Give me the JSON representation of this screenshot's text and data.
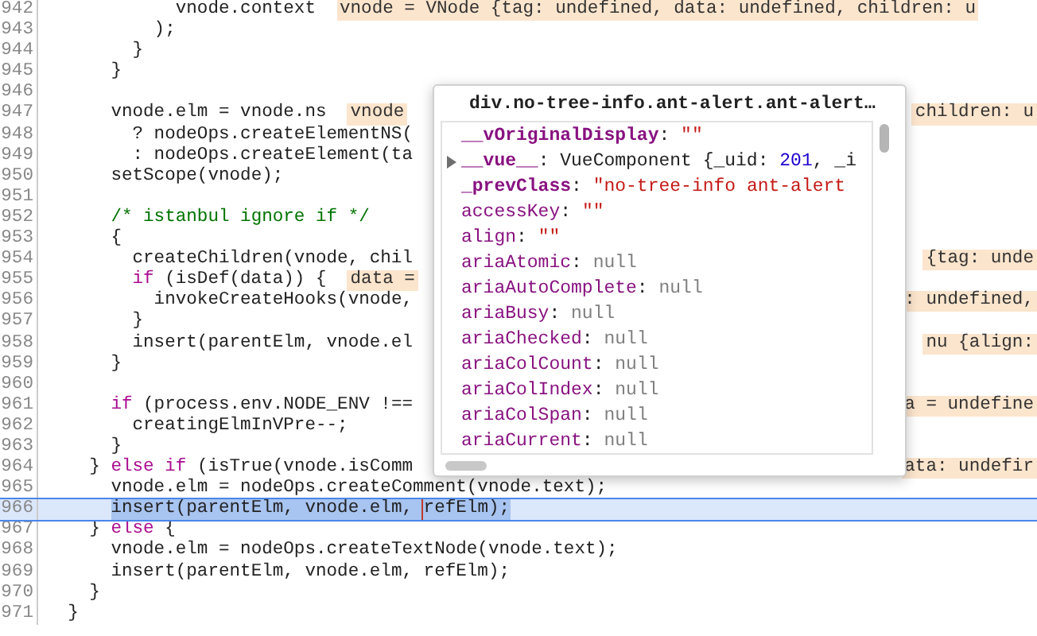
{
  "lines": [
    {
      "number": "942",
      "code": [
        {
          "text": "            vnode.context",
          "kind": "plain"
        }
      ],
      "note_left": "vnode = VNode {tag: undefined, data: undefined, children: u"
    },
    {
      "number": "943",
      "code": [
        {
          "text": "          );",
          "kind": "plain"
        }
      ]
    },
    {
      "number": "944",
      "code": [
        {
          "text": "        }",
          "kind": "plain"
        }
      ]
    },
    {
      "number": "945",
      "code": [
        {
          "text": "      }",
          "kind": "plain"
        }
      ]
    },
    {
      "number": "946"
    },
    {
      "number": "947",
      "code": [
        {
          "text": "      vnode.elm = vnode.ns",
          "kind": "plain"
        }
      ],
      "note_left": "vnode",
      "note_right": "children: u"
    },
    {
      "number": "948",
      "code": [
        {
          "text": "        ? nodeOps.createElementNS(",
          "kind": "plain"
        }
      ]
    },
    {
      "number": "949",
      "code": [
        {
          "text": "        : nodeOps.createElement(ta",
          "kind": "plain"
        }
      ]
    },
    {
      "number": "950",
      "code": [
        {
          "text": "      setScope(vnode);",
          "kind": "plain"
        }
      ]
    },
    {
      "number": "951"
    },
    {
      "number": "952",
      "code": [
        {
          "text": "      /* istanbul ignore if */",
          "kind": "comment"
        }
      ]
    },
    {
      "number": "953",
      "code": [
        {
          "text": "      {",
          "kind": "plain"
        }
      ]
    },
    {
      "number": "954",
      "code": [
        {
          "text": "        createChildren(vnode, chil",
          "kind": "plain"
        }
      ],
      "note_right": "{tag: unde"
    },
    {
      "number": "955",
      "code": [
        {
          "text": "        if",
          "kind": "keyword"
        },
        {
          "text": " (isDef(data)) {",
          "kind": "plain"
        }
      ],
      "note_left": "data ="
    },
    {
      "number": "956",
      "code": [
        {
          "text": "          invokeCreateHooks(vnode,",
          "kind": "plain"
        }
      ],
      "note_right": ": undefined,"
    },
    {
      "number": "957",
      "code": [
        {
          "text": "        }",
          "kind": "plain"
        }
      ]
    },
    {
      "number": "958",
      "code": [
        {
          "text": "        insert(parentElm, vnode.el",
          "kind": "plain"
        }
      ],
      "note_right": "nu {align:"
    },
    {
      "number": "959",
      "code": [
        {
          "text": "      }",
          "kind": "plain"
        }
      ]
    },
    {
      "number": "960"
    },
    {
      "number": "961",
      "code": [
        {
          "text": "      if",
          "kind": "keyword"
        },
        {
          "text": " (process.env.NODE_ENV !==",
          "kind": "plain"
        }
      ],
      "note_right": "a = undefine"
    },
    {
      "number": "962",
      "code": [
        {
          "text": "        creatingElmInVPre--;",
          "kind": "plain"
        }
      ]
    },
    {
      "number": "963",
      "code": [
        {
          "text": "      }",
          "kind": "plain"
        }
      ]
    },
    {
      "number": "964",
      "code": [
        {
          "text": "    } ",
          "kind": "plain"
        },
        {
          "text": "else if",
          "kind": "keyword"
        },
        {
          "text": " (isTrue(vnode.isComm",
          "kind": "plain"
        }
      ],
      "note_right": "ata: undefir"
    },
    {
      "number": "965",
      "code": [
        {
          "text": "      vnode.elm = nodeOps.createComment(vnode.text);",
          "kind": "plain"
        }
      ]
    },
    {
      "number": "966",
      "current": true,
      "code": [
        {
          "text": "      insert(parentElm, vnode.elm, ",
          "kind": "selected"
        },
        {
          "text": "refElm",
          "kind": "hovered"
        },
        {
          "text": ");",
          "kind": "selected"
        }
      ]
    },
    {
      "number": "967",
      "code": [
        {
          "text": "    } ",
          "kind": "plain"
        },
        {
          "text": "else",
          "kind": "keyword"
        },
        {
          "text": " {",
          "kind": "plain"
        }
      ]
    },
    {
      "number": "968",
      "code": [
        {
          "text": "      vnode.elm = nodeOps.createTextNode(vnode.text);",
          "kind": "plain"
        }
      ]
    },
    {
      "number": "969",
      "code": [
        {
          "text": "      insert(parentElm, vnode.elm, refElm);",
          "kind": "plain"
        }
      ]
    },
    {
      "number": "970",
      "code": [
        {
          "text": "    }",
          "kind": "plain"
        }
      ]
    },
    {
      "number": "971",
      "code": [
        {
          "text": "  }",
          "kind": "plain"
        }
      ]
    }
  ],
  "popover": {
    "title": "div.no-tree-info.ant-alert.ant-alert…",
    "properties": [
      {
        "name": "__vOriginalDisplay",
        "bold": true,
        "expandable": false,
        "value": [
          {
            "text": ": ",
            "kind": "plain"
          },
          {
            "text": "\"\"",
            "kind": "string"
          }
        ]
      },
      {
        "name": "__vue__",
        "bold": true,
        "expandable": true,
        "value": [
          {
            "text": ": VueComponent {_uid: ",
            "kind": "plain"
          },
          {
            "text": "201",
            "kind": "number"
          },
          {
            "text": ", _i",
            "kind": "plain"
          }
        ]
      },
      {
        "name": "_prevClass",
        "bold": true,
        "expandable": false,
        "value": [
          {
            "text": ": ",
            "kind": "plain"
          },
          {
            "text": "\"no-tree-info ant-alert",
            "kind": "string"
          }
        ]
      },
      {
        "name": "accessKey",
        "bold": false,
        "expandable": false,
        "value": [
          {
            "text": ": ",
            "kind": "plain"
          },
          {
            "text": "\"\"",
            "kind": "string"
          }
        ]
      },
      {
        "name": "align",
        "bold": false,
        "expandable": false,
        "value": [
          {
            "text": ": ",
            "kind": "plain"
          },
          {
            "text": "\"\"",
            "kind": "string"
          }
        ]
      },
      {
        "name": "ariaAtomic",
        "bold": false,
        "expandable": false,
        "value": [
          {
            "text": ": ",
            "kind": "plain"
          },
          {
            "text": "null",
            "kind": "null"
          }
        ]
      },
      {
        "name": "ariaAutoComplete",
        "bold": false,
        "expandable": false,
        "value": [
          {
            "text": ": ",
            "kind": "plain"
          },
          {
            "text": "null",
            "kind": "null"
          }
        ]
      },
      {
        "name": "ariaBusy",
        "bold": false,
        "expandable": false,
        "value": [
          {
            "text": ": ",
            "kind": "plain"
          },
          {
            "text": "null",
            "kind": "null"
          }
        ]
      },
      {
        "name": "ariaChecked",
        "bold": false,
        "expandable": false,
        "value": [
          {
            "text": ": ",
            "kind": "plain"
          },
          {
            "text": "null",
            "kind": "null"
          }
        ]
      },
      {
        "name": "ariaColCount",
        "bold": false,
        "expandable": false,
        "value": [
          {
            "text": ": ",
            "kind": "plain"
          },
          {
            "text": "null",
            "kind": "null"
          }
        ]
      },
      {
        "name": "ariaColIndex",
        "bold": false,
        "expandable": false,
        "value": [
          {
            "text": ": ",
            "kind": "plain"
          },
          {
            "text": "null",
            "kind": "null"
          }
        ]
      },
      {
        "name": "ariaColSpan",
        "bold": false,
        "expandable": false,
        "value": [
          {
            "text": ": ",
            "kind": "plain"
          },
          {
            "text": "null",
            "kind": "null"
          }
        ]
      },
      {
        "name": "ariaCurrent",
        "bold": false,
        "expandable": false,
        "value": [
          {
            "text": ": ",
            "kind": "plain"
          },
          {
            "text": "null",
            "kind": "null"
          }
        ]
      }
    ]
  }
}
